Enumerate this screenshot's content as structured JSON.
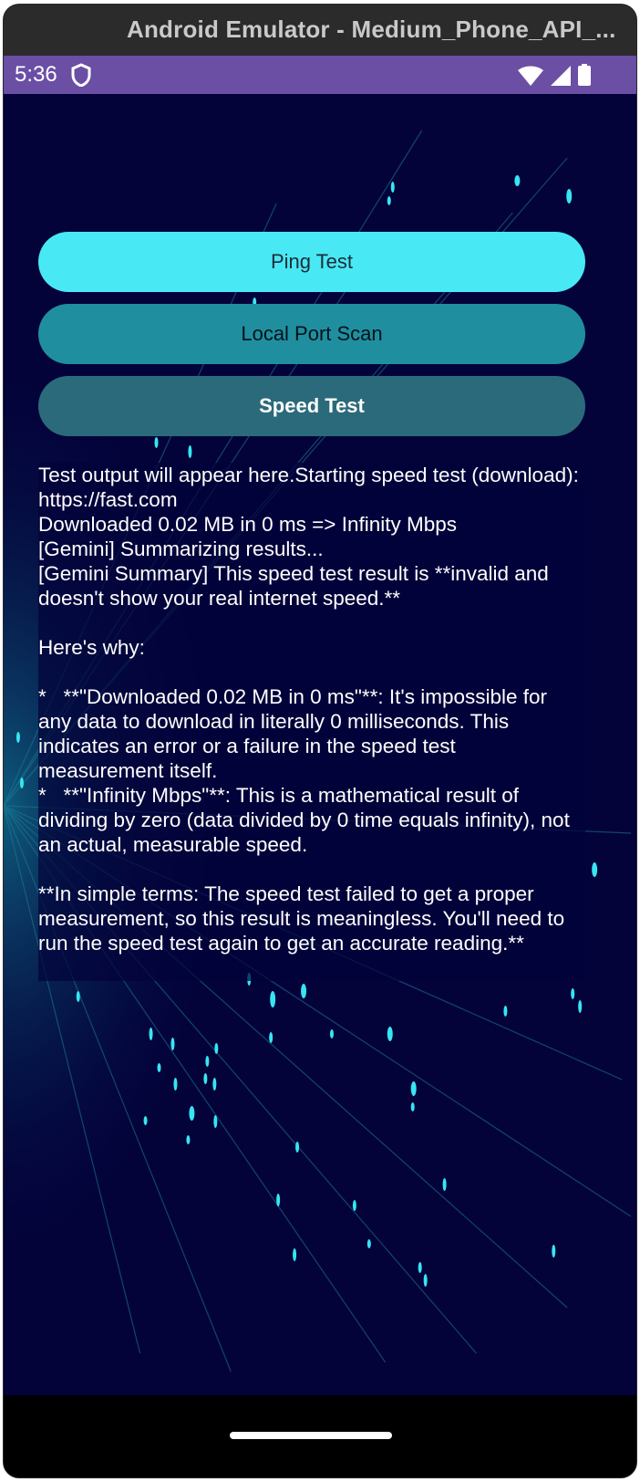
{
  "window": {
    "title": "Android Emulator - Medium_Phone_API_..."
  },
  "status_bar": {
    "time": "5:36",
    "icons": [
      "shield-icon",
      "wifi-icon",
      "signal-icon",
      "battery-icon"
    ]
  },
  "buttons": {
    "ping": "Ping Test",
    "port_scan": "Local Port Scan",
    "speed": "Speed Test"
  },
  "output": {
    "text": "Test output will appear here.Starting speed test (download): https://fast.com\nDownloaded 0.02 MB in 0 ms => Infinity Mbps\n[Gemini] Summarizing results...\n[Gemini Summary] This speed test result is **invalid and doesn't show your real internet speed.**\n\nHere's why:\n\n*   **\"Downloaded 0.02 MB in 0 ms\"**: It's impossible for any data to download in literally 0 milliseconds. This indicates an error or a failure in the speed test measurement itself.\n*   **\"Infinity Mbps\"**: This is a mathematical result of dividing by zero (data divided by 0 time equals infinity), not an actual, measurable speed.\n\n**In simple terms: The speed test failed to get a proper measurement, so this result is meaningless. You'll need to run the speed test again to get an accurate reading.**"
  },
  "colors": {
    "status_bar": "#6a4fa5",
    "screen_bg": "#03033a",
    "ping_button": "#48e9f4",
    "port_button": "#1f8fa0",
    "speed_button": "#2b6a7a",
    "accent": "#32e3f0"
  }
}
